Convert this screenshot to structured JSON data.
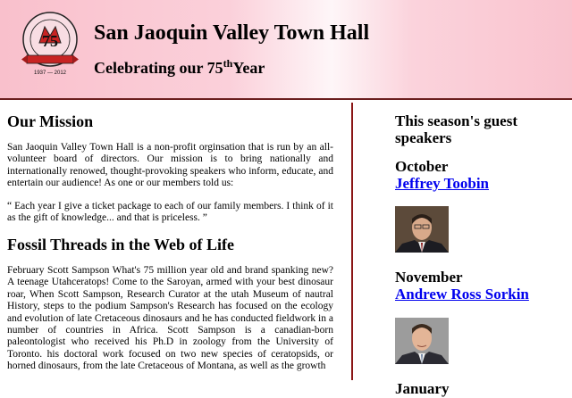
{
  "header": {
    "title": "San Jaoquin Valley Town Hall",
    "tagline_prefix": "Celebrating our 75",
    "tagline_sup": "th",
    "tagline_suffix": "Year",
    "logo_text": "SAN JOAQUIN VALLEY TOWN HALL",
    "logo_number": "75",
    "logo_years": "1937 — 2012"
  },
  "main": {
    "mission_heading": "Our Mission",
    "mission_text": "San Jaoquin Valley Town Hall is a non-profit orginsation that is run by an all-volunteer board of directors. Our mission is to bring nationally and internationally renowed, thought-provoking speakers who inform, educate, and entertain our audience! As one or our members told us:",
    "quote": "“ Each year I give a ticket package to each of our family members. I think of it as the gift of knowledge... and that is priceless. ”",
    "fossil_heading": "Fossil Threads in the Web of Life",
    "fossil_text": "February Scott Sampson What's 75 million year old and brand spanking new? A teenage Utahceratops! Come to the Saroyan, armed with your best dinosaur roar, When Scott Sampson, Research Curator at the utah Museum of nautral History, steps to the podium Sampson's Research has focused on the ecology and evolution of late Cretaceous dinosaurs and he has conducted fieldwork in a number of countries in Africa. Scott Sampson is a canadian-born paleontologist who received his Ph.D in zoology from the University of Toronto. his doctoral work focused on two new species of ceratopsids, or horned dinosaurs, from the late Cretaceous of Montana, as well as the growth"
  },
  "aside": {
    "heading": "This season's guest speakers",
    "speakers": [
      {
        "month": "October",
        "name": "Jeffrey Toobin"
      },
      {
        "month": "November",
        "name": "Andrew Ross Sorkin"
      },
      {
        "month": "January",
        "name": ""
      }
    ]
  },
  "colors": {
    "header_pink": "#f9c0cc",
    "divider": "#8a1515",
    "link": "#0000ee"
  }
}
